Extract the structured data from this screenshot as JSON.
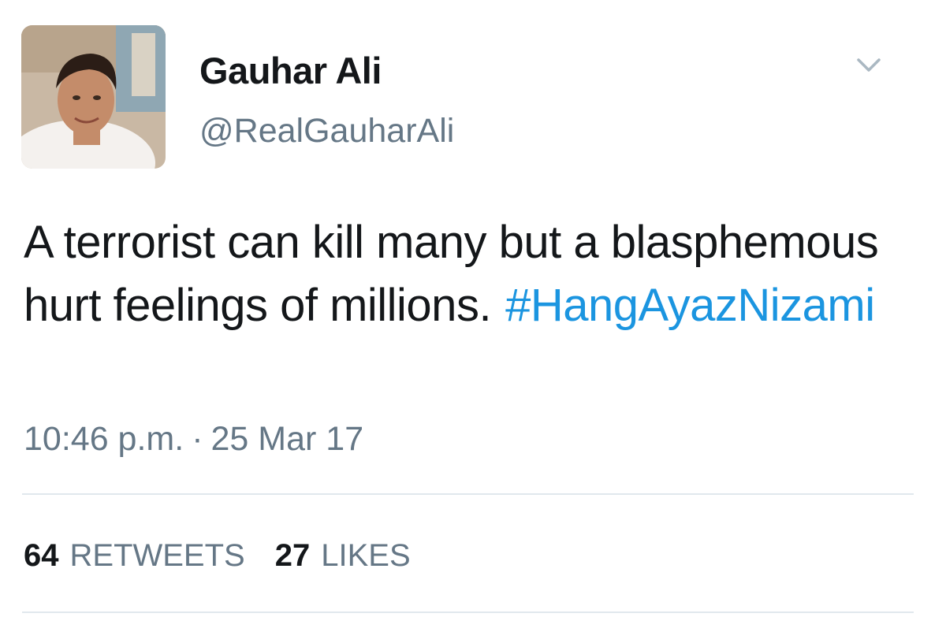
{
  "tweet": {
    "author": {
      "display_name": "Gauhar Ali",
      "handle": "@RealGauharAli"
    },
    "text": "A terrorist can kill many but a blasphemous hurt feelings of millions.",
    "hashtag": "#HangAyazNizami",
    "time": "10:46 p.m.",
    "separator": "·",
    "date": "25 Mar 17",
    "stats": {
      "retweets_count": "64",
      "retweets_label": "RETWEETS",
      "likes_count": "27",
      "likes_label": "LIKES"
    }
  },
  "icons": {
    "menu": "chevron-down-icon",
    "avatar": "profile-photo"
  },
  "colors": {
    "text": "#14171a",
    "secondary": "#657786",
    "link": "#1b95e0",
    "divider": "#e1e8ed"
  }
}
